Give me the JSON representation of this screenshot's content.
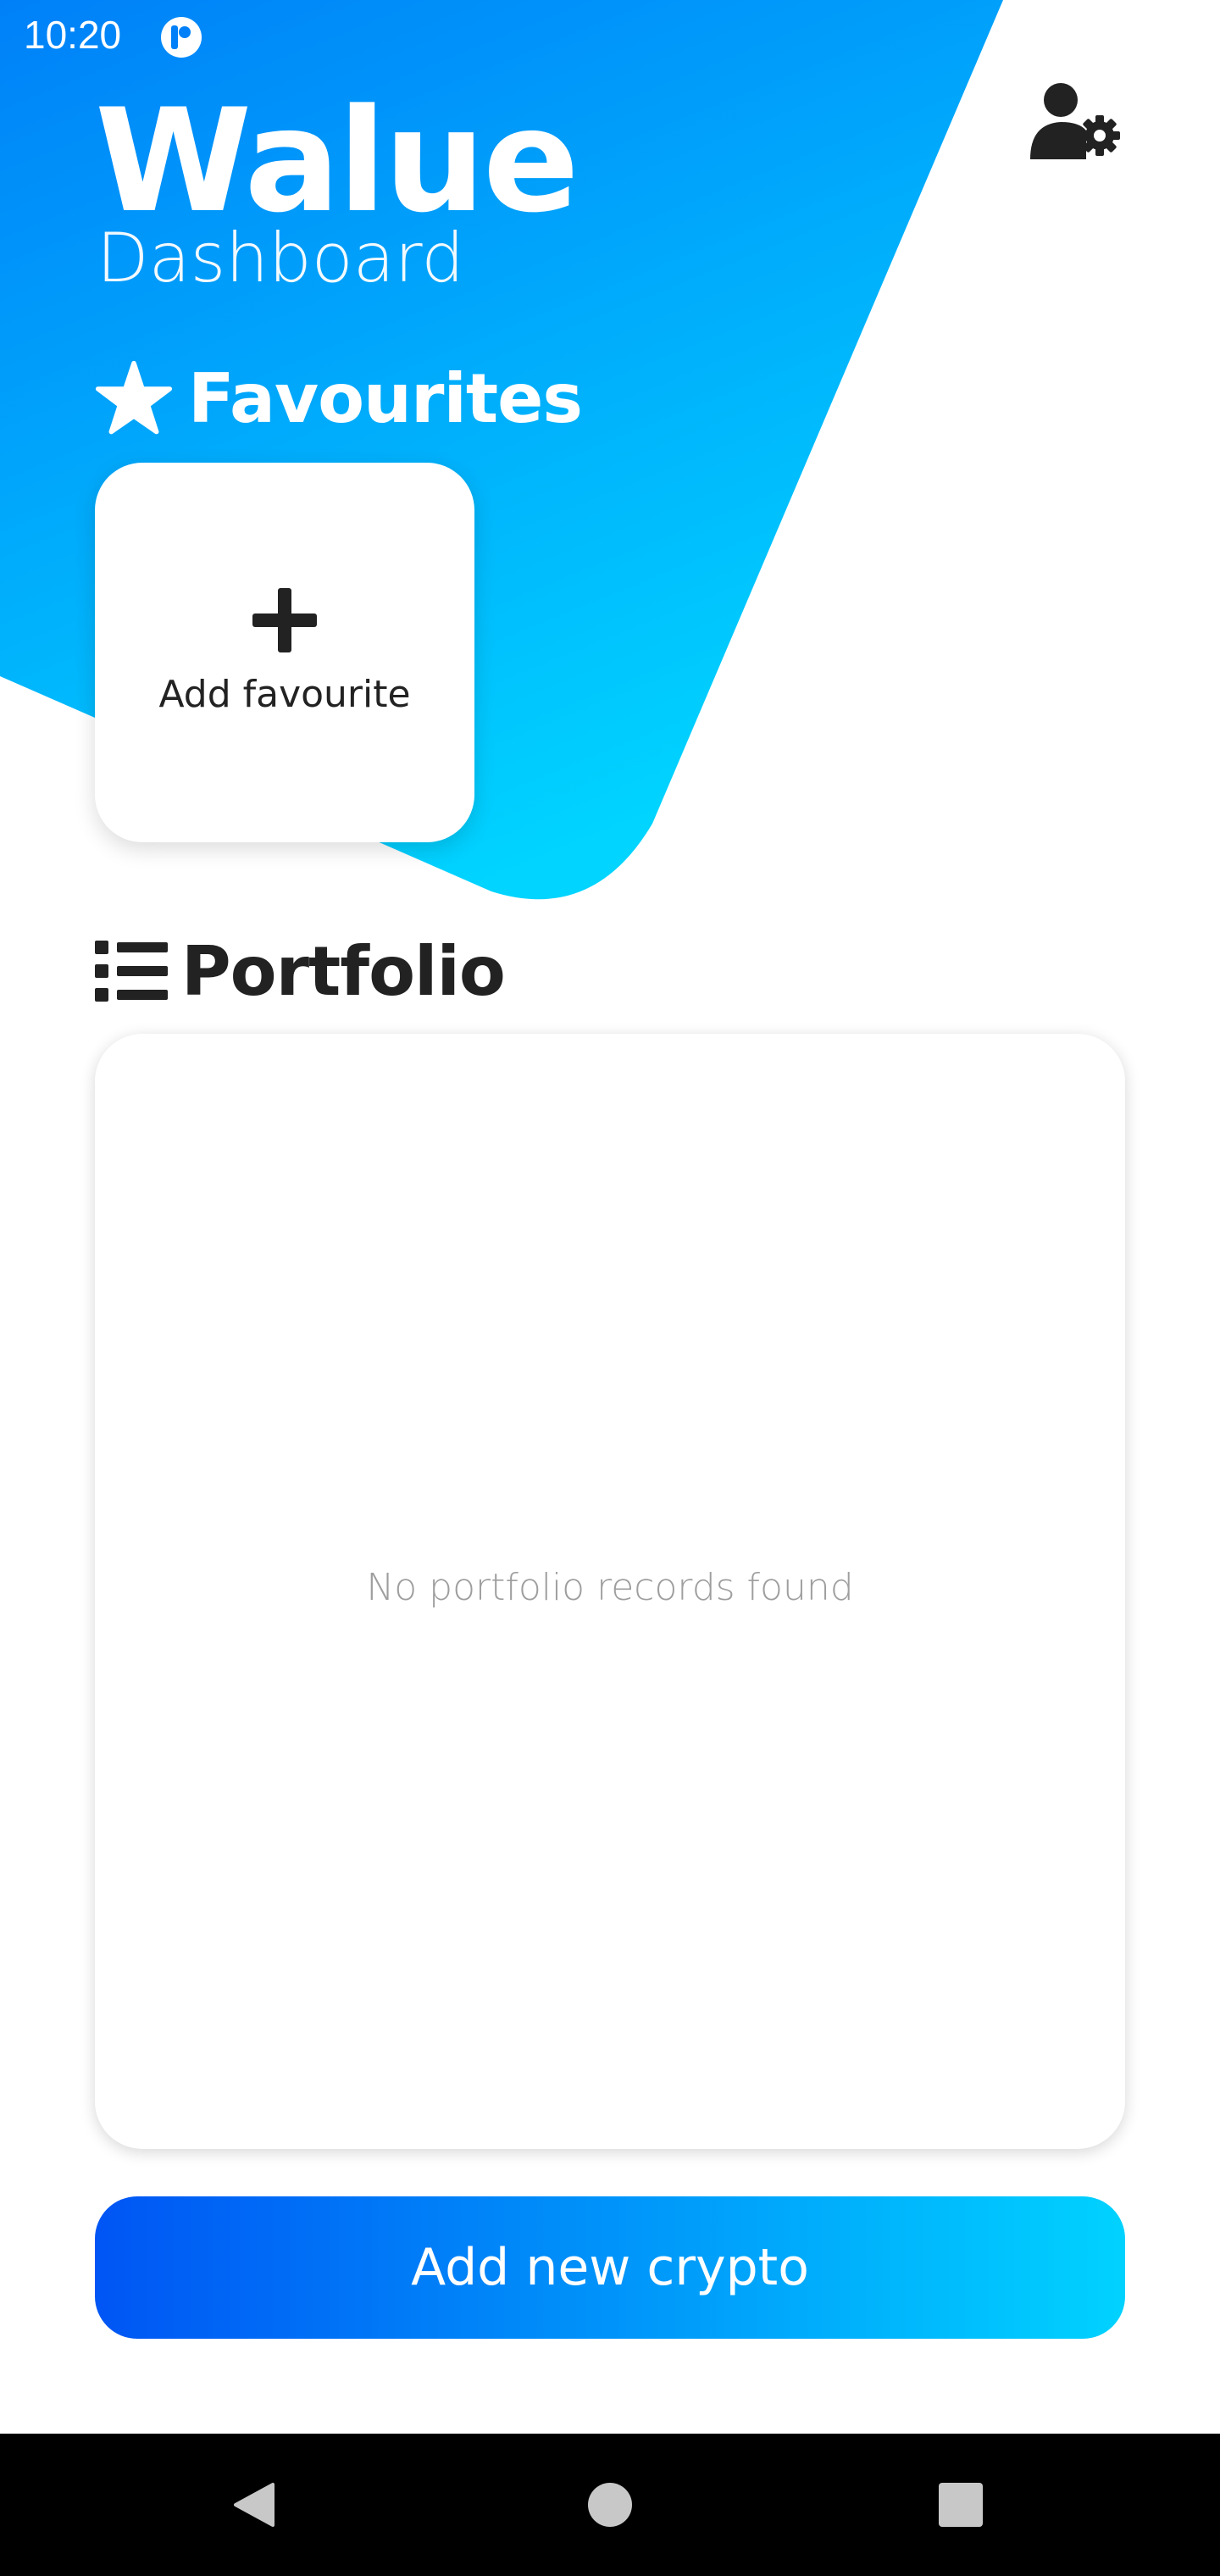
{
  "status_bar": {
    "time": "10:20"
  },
  "header": {
    "title": "Walue",
    "subtitle": "Dashboard"
  },
  "favourites": {
    "heading": "Favourites",
    "add_card_label": "Add favourite"
  },
  "portfolio": {
    "heading": "Portfolio",
    "empty_message": "No portfolio records found"
  },
  "actions": {
    "add_crypto_label": "Add new crypto"
  },
  "icons": {
    "user_settings": "user-gear-icon",
    "favourites": "star-icon",
    "add": "plus-icon",
    "portfolio": "list-icon",
    "nav_back": "back-triangle-icon",
    "nav_home": "home-circle-icon",
    "nav_recents": "recents-square-icon"
  },
  "colors": {
    "gradient_start": "#0080f8",
    "gradient_end": "#00d4ff",
    "button_start": "#0055f4",
    "button_end": "#00d2ff",
    "text_dark": "#222222",
    "text_muted": "#9e9e9e"
  }
}
